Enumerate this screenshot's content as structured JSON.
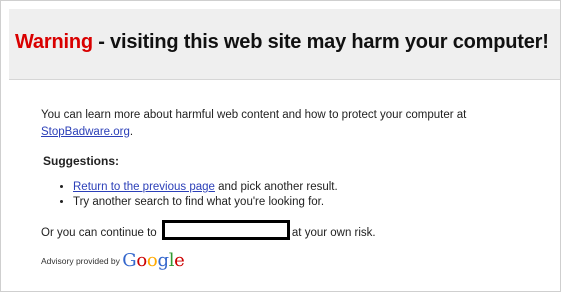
{
  "header": {
    "warning_word": "Warning",
    "headline_rest": " - visiting this web site may harm your computer!"
  },
  "body": {
    "intro_prefix": "You can learn more about harmful web content and how to protect your computer at ",
    "intro_link": "StopBadware.org",
    "intro_suffix": "."
  },
  "suggestions": {
    "title": "Suggestions:",
    "item1_link": "Return to the previous page",
    "item1_suffix": " and pick another result.",
    "item2": "Try another search to find what you're looking for."
  },
  "continue": {
    "prefix": "Or you can continue to ",
    "suffix": "at your own risk."
  },
  "advisory": {
    "text": "Advisory provided by ",
    "logo_letters": [
      "G",
      "o",
      "o",
      "g",
      "l",
      "e"
    ]
  },
  "colors": {
    "warning_red": "#d90000",
    "link_blue": "#2b3fb8",
    "header_bg": "#efefef",
    "google_colors": [
      "#3366cc",
      "#cc0000",
      "#ffaa00",
      "#3366cc",
      "#339933",
      "#cc0000"
    ]
  }
}
